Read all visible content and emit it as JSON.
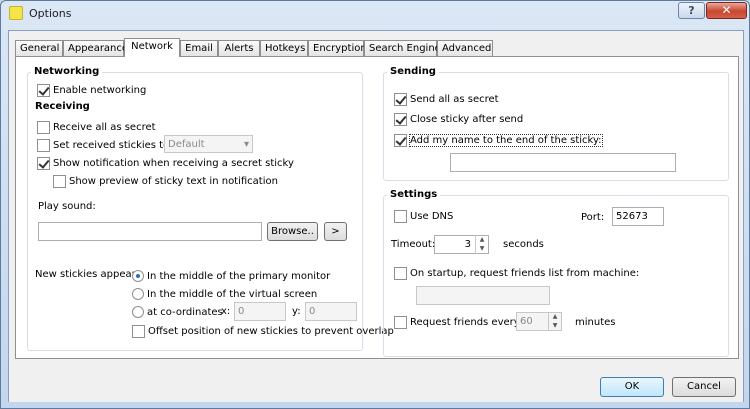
{
  "window": {
    "title": "Options",
    "help_glyph": "?",
    "close_glyph": "✕"
  },
  "tabs": [
    "General",
    "Appearance",
    "Network",
    "Email",
    "Alerts",
    "Hotkeys",
    "Encryption",
    "Search Engines",
    "Advanced"
  ],
  "active_tab": "Network",
  "networking": {
    "title": "Networking",
    "enable_networking": "Enable networking",
    "receiving_title": "Receiving",
    "receive_all_secret": "Receive all as secret",
    "set_received_stickies_to": "Set received stickies to",
    "received_stickies_select_value": "Default",
    "show_notification": "Show notification when receiving a secret sticky",
    "show_preview": "Show preview of sticky text in notification",
    "play_sound_label": "Play sound:",
    "play_sound_value": "",
    "browse_label": "Browse..",
    "play_label": ">",
    "new_stickies_label": "New stickies appear:",
    "opt_primary_monitor": "In the middle of the primary monitor",
    "opt_virtual_screen": "In the middle of the virtual screen",
    "opt_coordinates": "at co-ordinates",
    "x_label": "x:",
    "x_value": "0",
    "y_label": "y:",
    "y_value": "0",
    "offset_position": "Offset position of new stickies to prevent overlap"
  },
  "sending": {
    "title": "Sending",
    "send_all_secret": "Send all as secret",
    "close_after_send": "Close sticky after send",
    "add_my_name": "Add my name to the end of the sticky:",
    "name_value": ""
  },
  "settings": {
    "title": "Settings",
    "use_dns": "Use DNS",
    "port_label": "Port:",
    "port_value": "52673",
    "timeout_label": "Timeout:",
    "timeout_value": "3",
    "seconds_label": "seconds",
    "startup_request": "On startup, request friends list from machine:",
    "machine_value": "",
    "request_every": "Request friends every",
    "request_value": "60",
    "minutes_label": "minutes"
  },
  "buttons": {
    "ok": "OK",
    "cancel": "Cancel"
  },
  "colors": {
    "accent": "#2c6bb7",
    "window_frame": "#c2d6ee"
  }
}
